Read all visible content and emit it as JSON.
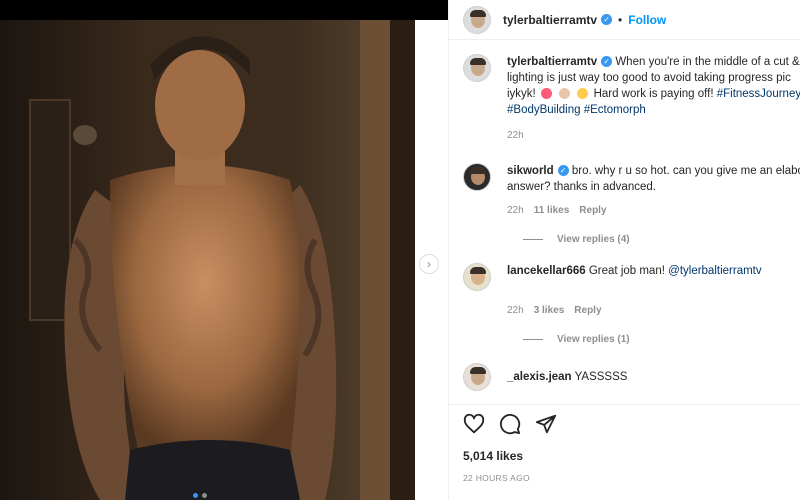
{
  "post": {
    "username": "tylerbaltierramtv",
    "separator": "•",
    "follow_label": "Follow"
  },
  "caption": {
    "username": "tylerbaltierramtv",
    "line1": "When you're in the middle of a cut &",
    "line2": "lighting is just way too good to avoid taking progress pic",
    "line3_prefix": "iykyk!",
    "line3_text": "Hard work is paying off!",
    "hashtag1": "#FitnessJourney",
    "hashtag2": "#BodyBuilding",
    "hashtag3": "#Ectomorph",
    "time": "22h"
  },
  "comments": [
    {
      "username": "sikworld",
      "line1": "bro. why r u so hot. can you give me an elabo",
      "line2": "answer? thanks in advanced.",
      "time": "22h",
      "likes": "11 likes",
      "reply": "Reply",
      "view_replies": "View replies (4)"
    },
    {
      "username": "lancekellar666",
      "text": "Great job man!",
      "mention": "@tylerbaltierramtv",
      "time": "22h",
      "likes": "3 likes",
      "reply": "Reply",
      "view_replies": "View replies (1)"
    },
    {
      "username": "_alexis.jean",
      "text": "YASSSSS"
    }
  ],
  "actions": {
    "likes_count": "5,014 likes",
    "timestamp": "22 HOURS AGO"
  },
  "carousel": {
    "total": 2,
    "active": 0
  },
  "colors": {
    "link": "#0095f6",
    "hashtag": "#00376b",
    "muted": "#8e8e8e",
    "verified": "#3897f0"
  }
}
